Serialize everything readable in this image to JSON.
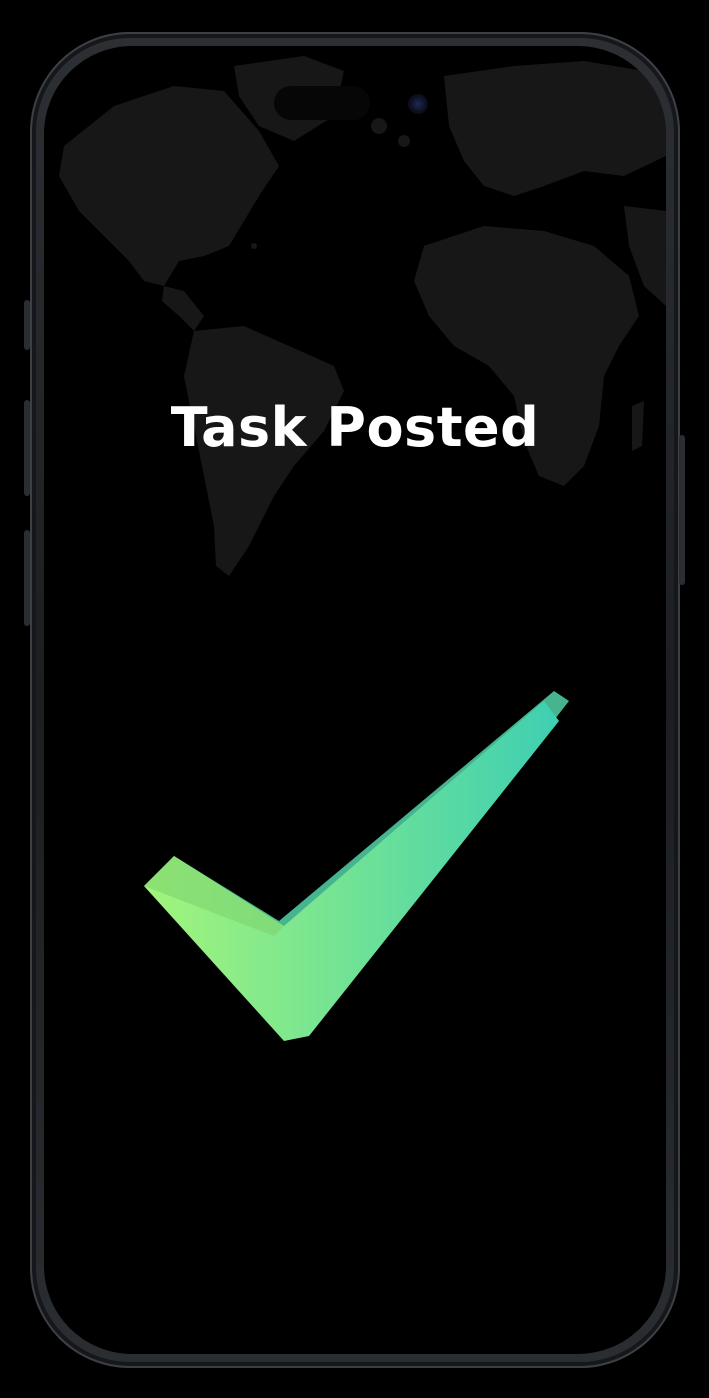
{
  "screen": {
    "title": "Task Posted",
    "background_color": "#000000",
    "map_color": "#171717"
  },
  "icons": {
    "status_icon": "checkmark-icon",
    "background": "world-map-illustration"
  },
  "colors": {
    "check_gradient_start": "#a3f57a",
    "check_gradient_end": "#3ecfb2",
    "check_shadow": "#46b58f"
  }
}
